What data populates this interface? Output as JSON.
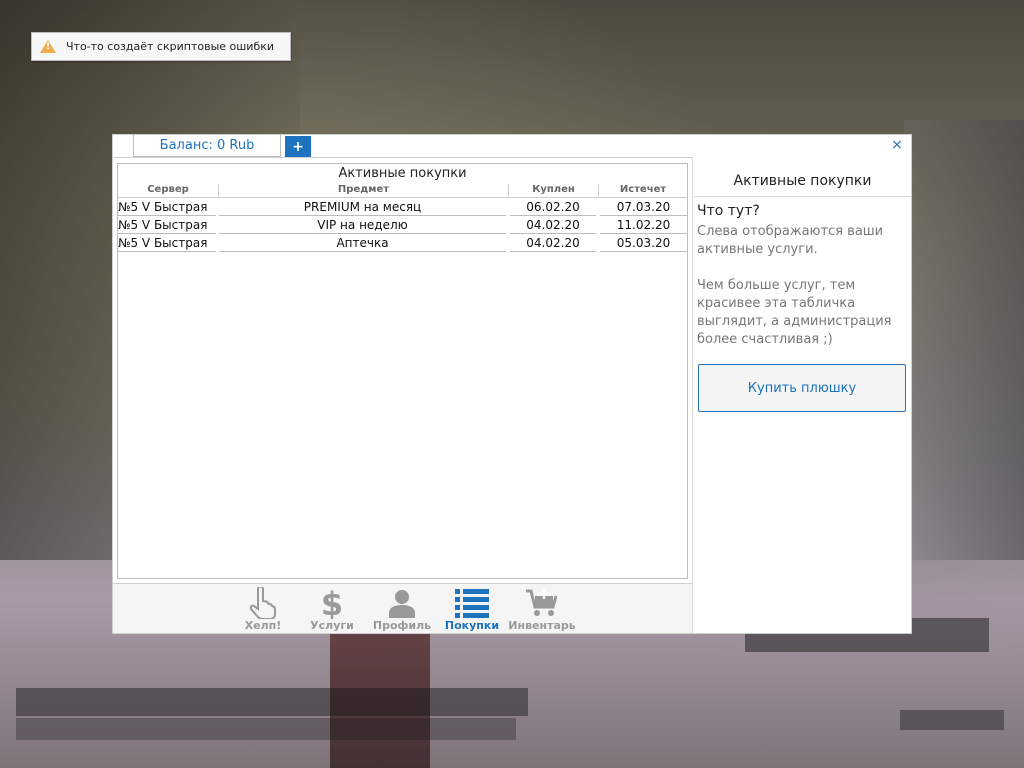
{
  "notification": {
    "icon": "warning-icon",
    "text": "Что-то создаёт скриптовые ошибки"
  },
  "header": {
    "balance_label": "Баланс: 0 Rub",
    "add_funds_label": "+",
    "close_label": "×"
  },
  "table": {
    "title": "Активные покупки",
    "columns": [
      "Сервер",
      "Предмет",
      "Куплен",
      "Истечет"
    ],
    "rows": [
      {
        "server": "№5 V Быстрая",
        "item": "PREMIUM на месяц",
        "bought": "06.02.20",
        "expires": "07.03.20"
      },
      {
        "server": "№5 V Быстрая",
        "item": "VIP на неделю",
        "bought": "04.02.20",
        "expires": "11.02.20"
      },
      {
        "server": "№5 V Быстрая",
        "item": "Аптечка",
        "bought": "04.02.20",
        "expires": "05.03.20"
      }
    ]
  },
  "side": {
    "title": "Активные покупки",
    "question": "Что тут?",
    "para1": "Слева отображаются ваши активные услуги.",
    "para2": "Чем больше услуг, тем красивее эта табличка выглядит, а администрация более счастливая ;)",
    "button_label": "Купить плюшку"
  },
  "nav": {
    "items": [
      {
        "label": "Хелп!",
        "icon": "pointing-hand-icon"
      },
      {
        "label": "Услуги",
        "icon": "dollar-icon"
      },
      {
        "label": "Профиль",
        "icon": "user-icon"
      },
      {
        "label": "Покупки",
        "icon": "list-icon"
      },
      {
        "label": "Инвентарь",
        "icon": "cart-icon"
      }
    ],
    "active_index": 3
  },
  "colors": {
    "accent": "#1e73be",
    "inactive_nav": "#999999",
    "warning": "#f0ad4e"
  }
}
